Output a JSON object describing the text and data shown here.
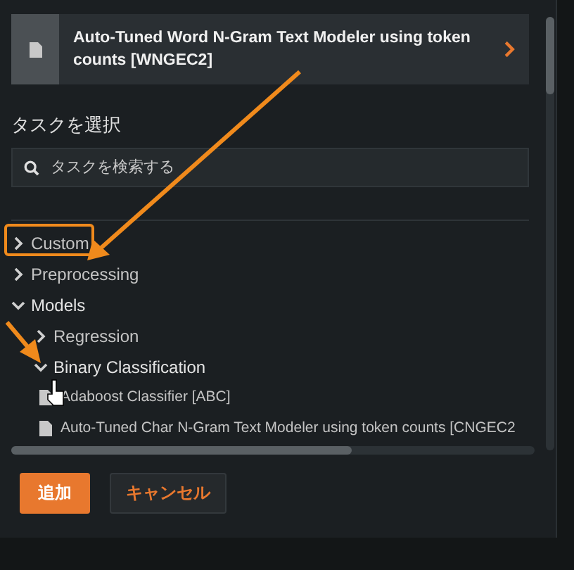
{
  "selected_task": {
    "title": "Auto-Tuned Word N-Gram Text Modeler using token counts [WNGEC2]"
  },
  "task_picker": {
    "label": "タスクを選択",
    "search": {
      "placeholder": "タスクを検索する"
    }
  },
  "tree": [
    {
      "label": "Custom",
      "kind": "group",
      "expanded": false
    },
    {
      "label": "Preprocessing",
      "kind": "group",
      "expanded": false
    },
    {
      "label": "Models",
      "kind": "group",
      "expanded": true,
      "children": [
        {
          "label": "Regression",
          "kind": "group",
          "expanded": false
        },
        {
          "label": "Binary Classification",
          "kind": "group",
          "expanded": true,
          "children": [
            {
              "label": "Adaboost Classifier [ABC]",
              "kind": "task"
            },
            {
              "label": "Auto-Tuned Char N-Gram Text Modeler using token counts [CNGEC2",
              "kind": "task"
            }
          ]
        }
      ]
    }
  ],
  "buttons": [
    {
      "label": "追加",
      "kind": "primary"
    },
    {
      "label": "キャンセル",
      "kind": "secondary"
    }
  ]
}
